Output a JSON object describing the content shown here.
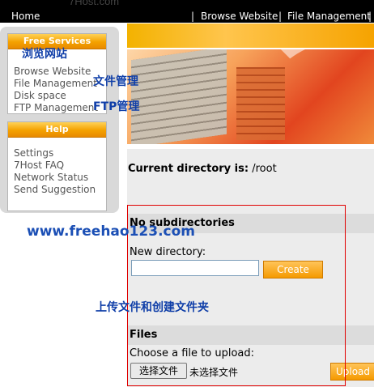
{
  "header": {
    "logo_text": "7Host.com",
    "nav": {
      "home": "Home",
      "separator": "|",
      "browse": "Browse Website",
      "files": "File Management"
    }
  },
  "sidebar": {
    "services_title": "Free Services",
    "services": [
      "Browse Website",
      "File Management",
      "Disk space",
      "FTP Management"
    ],
    "help_title": "Help",
    "help": [
      "Settings",
      "7Host FAQ",
      "Network Status",
      "Send Suggestion"
    ]
  },
  "annotations": {
    "browse": "浏览网站",
    "file": "文件管理",
    "ftp": "FTP管理",
    "site": "www.freehao123.com",
    "upload": "上传文件和创建文件夹"
  },
  "main": {
    "current_dir_label": "Current directory is:",
    "current_dir_value": "/root",
    "no_subdirs": "No subdirectories",
    "new_dir_label": "New directory:",
    "new_dir_value": "",
    "create_button": "Create",
    "files_heading": "Files",
    "choose_label": "Choose a file to upload:",
    "file_button": "选择文件",
    "file_status": "未选择文件",
    "upload_button": "Upload"
  },
  "colors": {
    "accent_orange": "#f4a100",
    "annotation_blue": "#0f3ea8",
    "highlight_red": "#e00000"
  }
}
